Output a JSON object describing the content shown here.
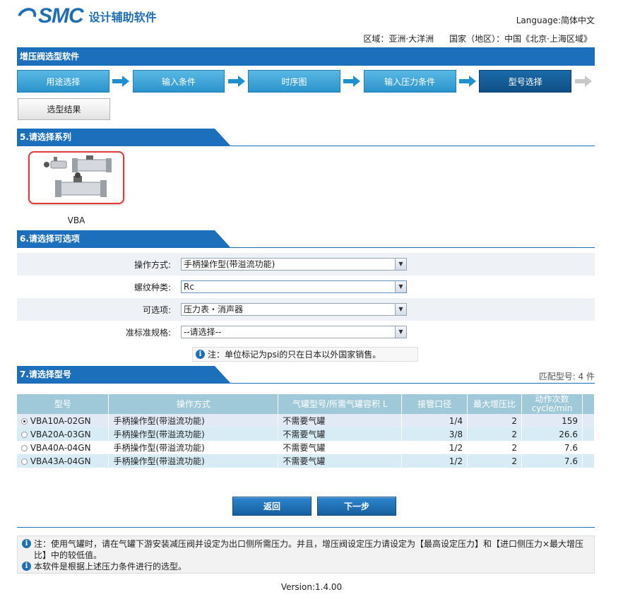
{
  "header": {
    "logo_text": "SMC",
    "app_name": "设计辅助软件",
    "language": "Language:简体中文",
    "region": "区域：亚洲·大洋洲",
    "country": "国家（地区）：中国《北京·上海区域》"
  },
  "title": "增压阀选型软件",
  "steps": [
    {
      "label": "用途选择"
    },
    {
      "label": "输入条件"
    },
    {
      "label": "时序图"
    },
    {
      "label": "输入压力条件"
    },
    {
      "label": "型号选择"
    }
  ],
  "result_button": "选型结果",
  "section5": {
    "title": "5.请选择系列",
    "product_label": "VBA"
  },
  "section6": {
    "title": "6.请选择可选项",
    "options": [
      {
        "label": "操作方式:",
        "value": "手柄操作型(带溢流功能)"
      },
      {
        "label": "螺纹种类:",
        "value": "Rc"
      },
      {
        "label": "可选项:",
        "value": "压力表・消声器"
      },
      {
        "label": "准标准规格:",
        "value": "--请选择--"
      }
    ],
    "note": "注：单位标记为psi的只在日本以外国家销售。"
  },
  "section7": {
    "title": "7.请选择型号",
    "match_count": "匹配型号: 4 件",
    "columns": [
      "型号",
      "操作方式",
      "气罐型号/所需气罐容积 L",
      "接管口径",
      "最大增压比",
      "动作次数 cycle/min"
    ],
    "rows": [
      {
        "selected": true,
        "model": "VBA10A-02GN",
        "operation": "手柄操作型(带溢流功能)",
        "tank": "不需要气罐",
        "port": "1/4",
        "ratio": "2",
        "cycles": "159"
      },
      {
        "selected": false,
        "model": "VBA20A-03GN",
        "operation": "手柄操作型(带溢流功能)",
        "tank": "不需要气罐",
        "port": "3/8",
        "ratio": "2",
        "cycles": "26.6"
      },
      {
        "selected": false,
        "model": "VBA40A-04GN",
        "operation": "手柄操作型(带溢流功能)",
        "tank": "不需要气罐",
        "port": "1/2",
        "ratio": "2",
        "cycles": "7.6"
      },
      {
        "selected": false,
        "model": "VBA43A-04GN",
        "operation": "手柄操作型(带溢流功能)",
        "tank": "不需要气罐",
        "port": "1/2",
        "ratio": "2",
        "cycles": "7.6"
      }
    ]
  },
  "buttons": {
    "back": "返回",
    "next": "下一步"
  },
  "footer_notes": [
    "注：使用气罐时，请在气罐下游安装减压阀并设定为出口侧所需压力。并且，增压阀设定压力请设定为【最高设定压力】和【进口侧压力×最大增压比】中的较低值。",
    "本软件是根据上述压力条件进行的选型。"
  ],
  "version": "Version:1.4.00",
  "colors": {
    "primary": "#1c6fba",
    "step": "#2a93cc",
    "step_active": "#104f86",
    "card_border": "#e03a3a"
  }
}
